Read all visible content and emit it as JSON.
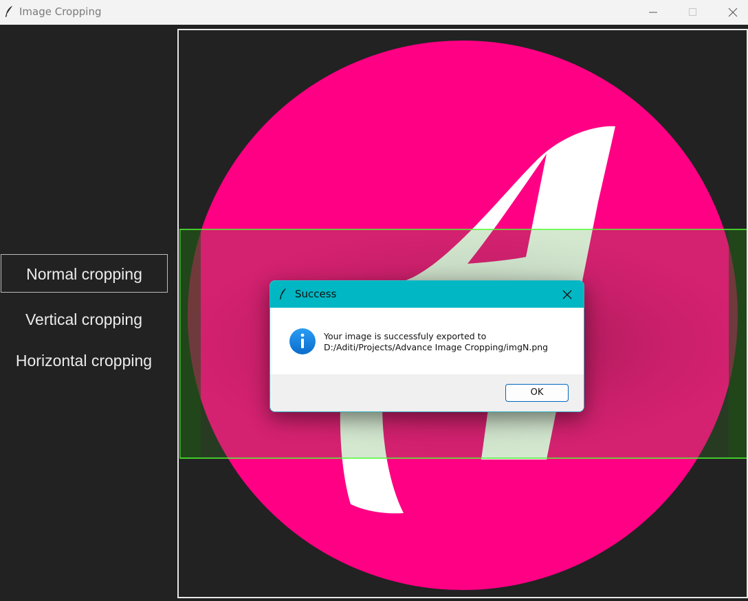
{
  "window": {
    "title": "Image Cropping"
  },
  "sidebar": {
    "items": [
      {
        "label": "Normal cropping",
        "active": true
      },
      {
        "label": "Vertical cropping",
        "active": false
      },
      {
        "label": "Horizontal cropping",
        "active": false
      }
    ]
  },
  "canvas": {
    "image_description_colors": {
      "circle": "#ff0084",
      "letter": "#ffffff",
      "selection_border": "#4cff2e"
    }
  },
  "dialog": {
    "title": "Success",
    "message_line1": "Your image is successfuly exported to",
    "message_line2": "D:/Aditi/Projects/Advance Image Cropping/imgN.png",
    "ok_label": "OK",
    "icon": "info-icon"
  },
  "colors": {
    "titlebar_bg": "#f3f3f3",
    "app_bg": "#222222",
    "dialog_header": "#00b7c3",
    "accent": "#0067c0"
  }
}
